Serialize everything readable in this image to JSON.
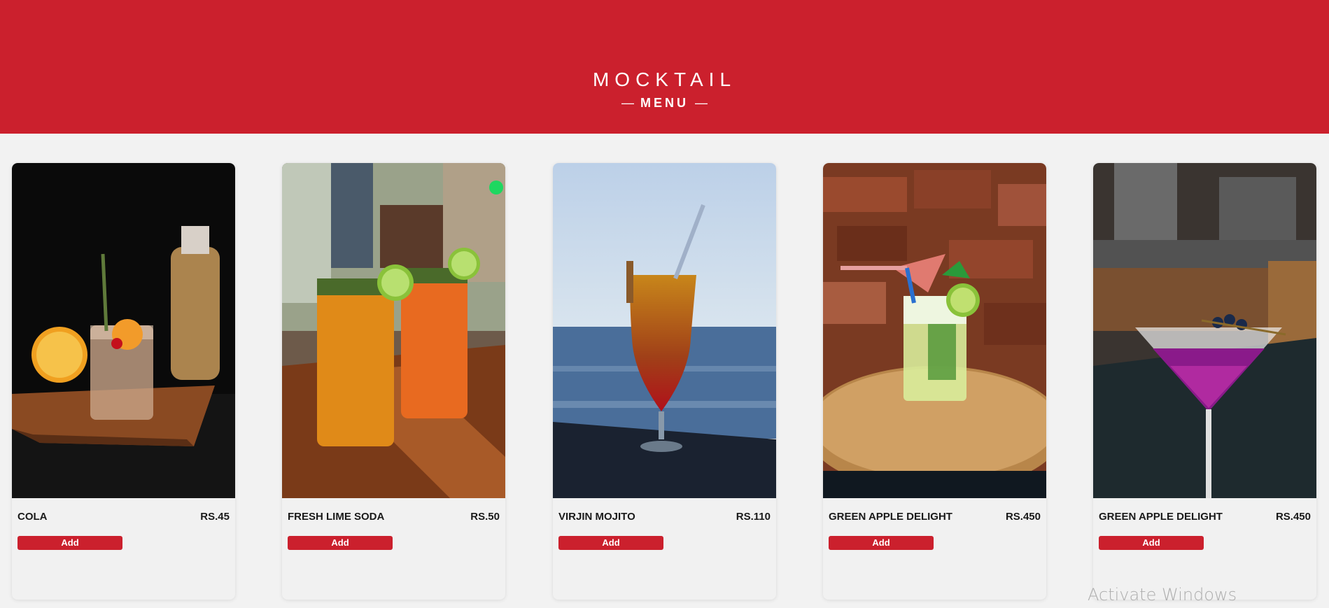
{
  "header": {
    "title": "MOCKTAIL",
    "subtitle": "MENU",
    "dash": "—",
    "background": "#cb202d"
  },
  "items": [
    {
      "name": "COLA",
      "price": "RS.45",
      "button": "Add",
      "image": "cocktail-with-orange-photo"
    },
    {
      "name": "FRESH LIME SODA",
      "price": "RS.50",
      "button": "Add",
      "image": "two-lime-soda-glasses-photo"
    },
    {
      "name": "VIRJIN MOJITO",
      "price": "RS.110",
      "button": "Add",
      "image": "hurricane-glass-by-sea-photo"
    },
    {
      "name": "GREEN APPLE DELIGHT",
      "price": "RS.450",
      "button": "Add",
      "image": "mojito-with-umbrella-photo"
    },
    {
      "name": "GREEN APPLE DELIGHT",
      "price": "RS.450",
      "button": "Add",
      "image": "purple-martini-photo"
    }
  ],
  "watermark": "Activate Windows",
  "accent": "#cb202d"
}
